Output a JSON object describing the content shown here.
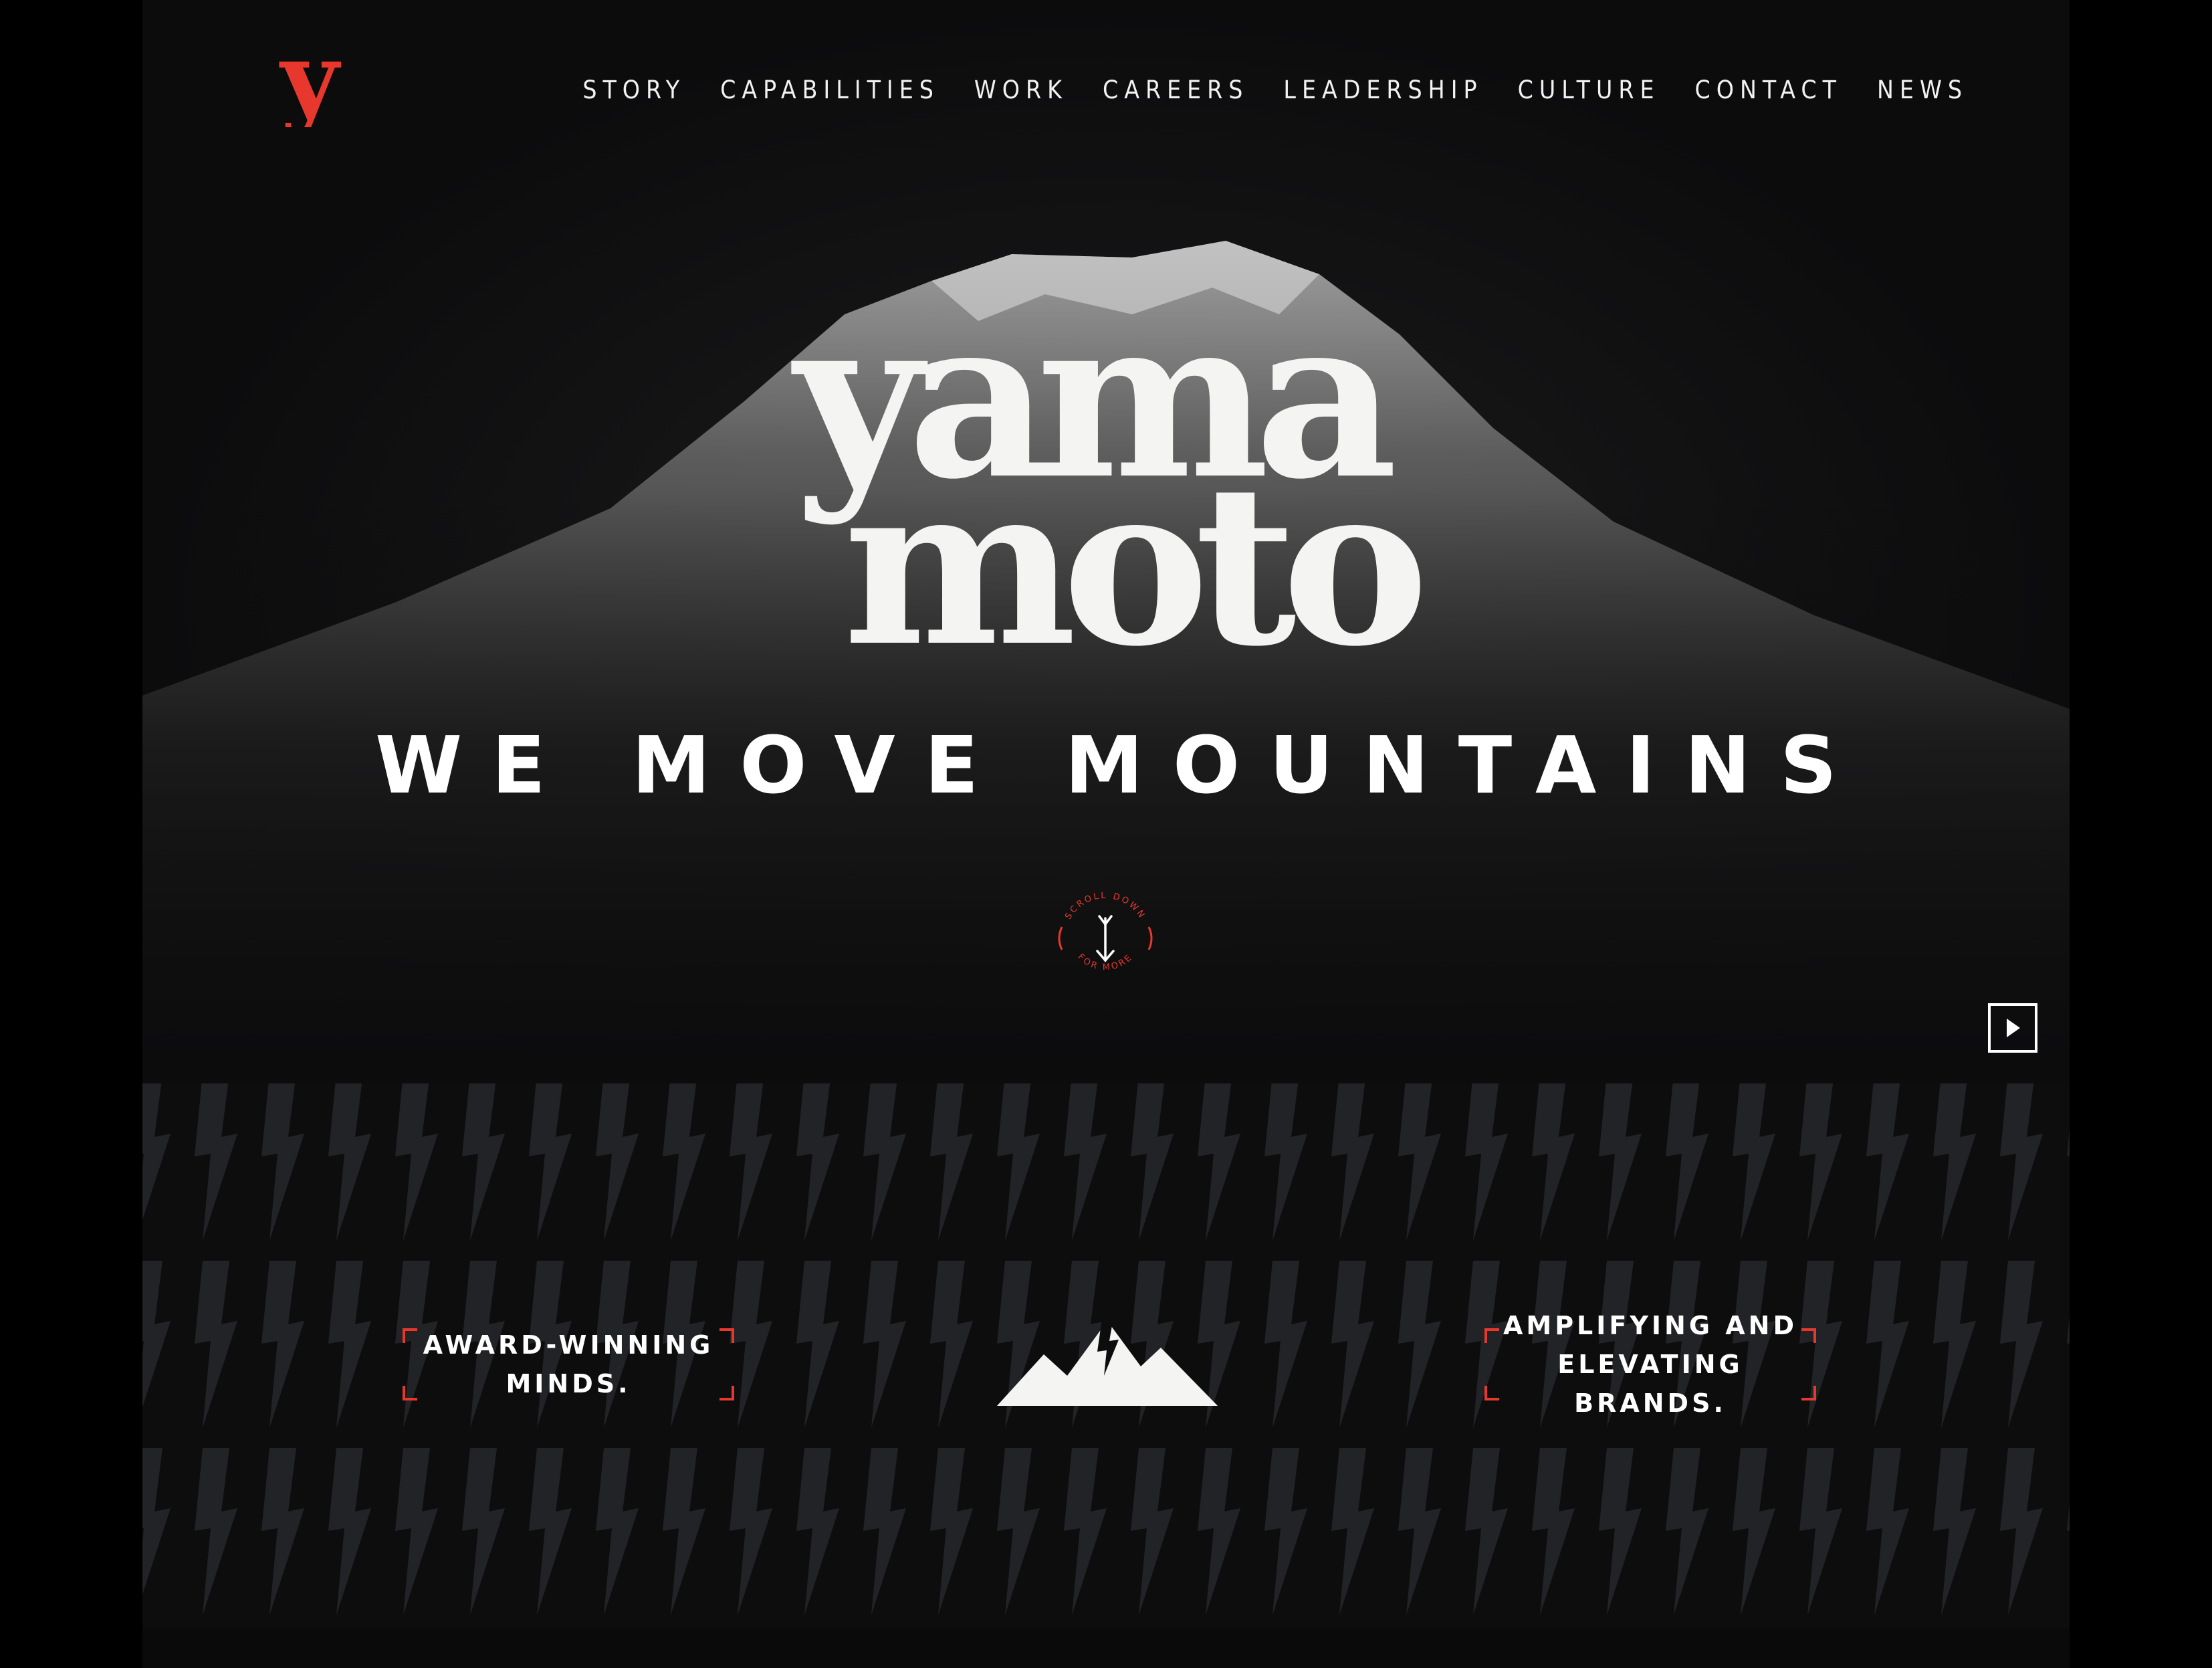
{
  "brand": {
    "logo_letter": "y",
    "wordmark_line1": "yama",
    "wordmark_line2": "moto",
    "tagline": "WE MOVE MOUNTAINS",
    "accent_color": "#e8382d"
  },
  "nav": {
    "items": [
      "STORY",
      "CAPABILITIES",
      "WORK",
      "CAREERS",
      "LEADERSHIP",
      "CULTURE",
      "CONTACT",
      "NEWS"
    ]
  },
  "scroll_badge": {
    "top_text": "SCROLL DOWN",
    "bottom_text": "FOR MORE",
    "icon": "arrow-down-icon"
  },
  "video": {
    "icon": "play-icon"
  },
  "features": {
    "left_line1": "AWARD-WINNING",
    "left_line2": "MINDS.",
    "right_line1": "AMPLIFYING AND",
    "right_line2": "ELEVATING BRANDS.",
    "center_icon": "mountain-lightning-icon"
  }
}
